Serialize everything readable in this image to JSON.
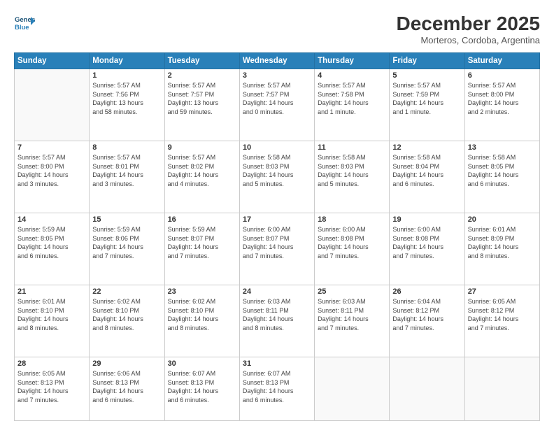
{
  "header": {
    "logo_line1": "General",
    "logo_line2": "Blue",
    "month": "December 2025",
    "location": "Morteros, Cordoba, Argentina"
  },
  "weekdays": [
    "Sunday",
    "Monday",
    "Tuesday",
    "Wednesday",
    "Thursday",
    "Friday",
    "Saturday"
  ],
  "weeks": [
    [
      {
        "day": "",
        "info": ""
      },
      {
        "day": "1",
        "info": "Sunrise: 5:57 AM\nSunset: 7:56 PM\nDaylight: 13 hours\nand 58 minutes."
      },
      {
        "day": "2",
        "info": "Sunrise: 5:57 AM\nSunset: 7:57 PM\nDaylight: 13 hours\nand 59 minutes."
      },
      {
        "day": "3",
        "info": "Sunrise: 5:57 AM\nSunset: 7:57 PM\nDaylight: 14 hours\nand 0 minutes."
      },
      {
        "day": "4",
        "info": "Sunrise: 5:57 AM\nSunset: 7:58 PM\nDaylight: 14 hours\nand 1 minute."
      },
      {
        "day": "5",
        "info": "Sunrise: 5:57 AM\nSunset: 7:59 PM\nDaylight: 14 hours\nand 1 minute."
      },
      {
        "day": "6",
        "info": "Sunrise: 5:57 AM\nSunset: 8:00 PM\nDaylight: 14 hours\nand 2 minutes."
      }
    ],
    [
      {
        "day": "7",
        "info": "Sunrise: 5:57 AM\nSunset: 8:00 PM\nDaylight: 14 hours\nand 3 minutes."
      },
      {
        "day": "8",
        "info": "Sunrise: 5:57 AM\nSunset: 8:01 PM\nDaylight: 14 hours\nand 3 minutes."
      },
      {
        "day": "9",
        "info": "Sunrise: 5:57 AM\nSunset: 8:02 PM\nDaylight: 14 hours\nand 4 minutes."
      },
      {
        "day": "10",
        "info": "Sunrise: 5:58 AM\nSunset: 8:03 PM\nDaylight: 14 hours\nand 5 minutes."
      },
      {
        "day": "11",
        "info": "Sunrise: 5:58 AM\nSunset: 8:03 PM\nDaylight: 14 hours\nand 5 minutes."
      },
      {
        "day": "12",
        "info": "Sunrise: 5:58 AM\nSunset: 8:04 PM\nDaylight: 14 hours\nand 6 minutes."
      },
      {
        "day": "13",
        "info": "Sunrise: 5:58 AM\nSunset: 8:05 PM\nDaylight: 14 hours\nand 6 minutes."
      }
    ],
    [
      {
        "day": "14",
        "info": "Sunrise: 5:59 AM\nSunset: 8:05 PM\nDaylight: 14 hours\nand 6 minutes."
      },
      {
        "day": "15",
        "info": "Sunrise: 5:59 AM\nSunset: 8:06 PM\nDaylight: 14 hours\nand 7 minutes."
      },
      {
        "day": "16",
        "info": "Sunrise: 5:59 AM\nSunset: 8:07 PM\nDaylight: 14 hours\nand 7 minutes."
      },
      {
        "day": "17",
        "info": "Sunrise: 6:00 AM\nSunset: 8:07 PM\nDaylight: 14 hours\nand 7 minutes."
      },
      {
        "day": "18",
        "info": "Sunrise: 6:00 AM\nSunset: 8:08 PM\nDaylight: 14 hours\nand 7 minutes."
      },
      {
        "day": "19",
        "info": "Sunrise: 6:00 AM\nSunset: 8:08 PM\nDaylight: 14 hours\nand 7 minutes."
      },
      {
        "day": "20",
        "info": "Sunrise: 6:01 AM\nSunset: 8:09 PM\nDaylight: 14 hours\nand 8 minutes."
      }
    ],
    [
      {
        "day": "21",
        "info": "Sunrise: 6:01 AM\nSunset: 8:10 PM\nDaylight: 14 hours\nand 8 minutes."
      },
      {
        "day": "22",
        "info": "Sunrise: 6:02 AM\nSunset: 8:10 PM\nDaylight: 14 hours\nand 8 minutes."
      },
      {
        "day": "23",
        "info": "Sunrise: 6:02 AM\nSunset: 8:10 PM\nDaylight: 14 hours\nand 8 minutes."
      },
      {
        "day": "24",
        "info": "Sunrise: 6:03 AM\nSunset: 8:11 PM\nDaylight: 14 hours\nand 8 minutes."
      },
      {
        "day": "25",
        "info": "Sunrise: 6:03 AM\nSunset: 8:11 PM\nDaylight: 14 hours\nand 7 minutes."
      },
      {
        "day": "26",
        "info": "Sunrise: 6:04 AM\nSunset: 8:12 PM\nDaylight: 14 hours\nand 7 minutes."
      },
      {
        "day": "27",
        "info": "Sunrise: 6:05 AM\nSunset: 8:12 PM\nDaylight: 14 hours\nand 7 minutes."
      }
    ],
    [
      {
        "day": "28",
        "info": "Sunrise: 6:05 AM\nSunset: 8:13 PM\nDaylight: 14 hours\nand 7 minutes."
      },
      {
        "day": "29",
        "info": "Sunrise: 6:06 AM\nSunset: 8:13 PM\nDaylight: 14 hours\nand 6 minutes."
      },
      {
        "day": "30",
        "info": "Sunrise: 6:07 AM\nSunset: 8:13 PM\nDaylight: 14 hours\nand 6 minutes."
      },
      {
        "day": "31",
        "info": "Sunrise: 6:07 AM\nSunset: 8:13 PM\nDaylight: 14 hours\nand 6 minutes."
      },
      {
        "day": "",
        "info": ""
      },
      {
        "day": "",
        "info": ""
      },
      {
        "day": "",
        "info": ""
      }
    ]
  ]
}
